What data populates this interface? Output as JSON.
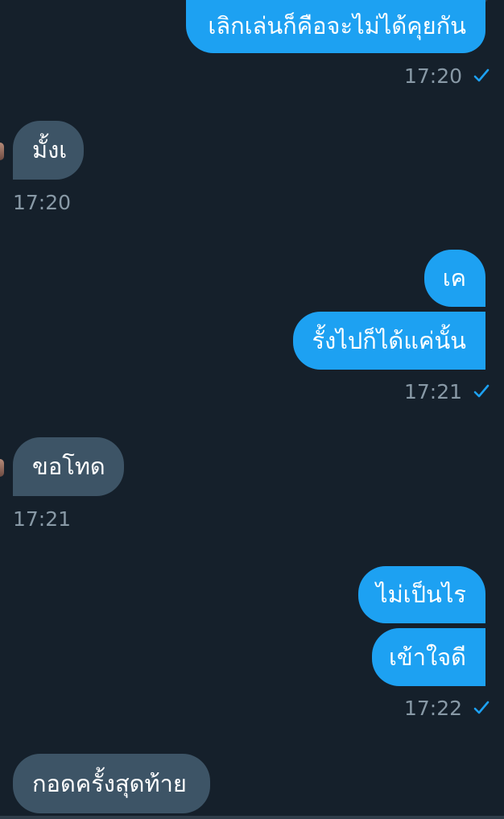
{
  "colors": {
    "background": "#15202b",
    "sent_bubble": "#1da1f2",
    "received_bubble": "#3d5466",
    "timestamp": "#8899a6",
    "read_check": "#1da1f2"
  },
  "messages": [
    {
      "direction": "sent",
      "text": "เลิกเล่นก็คือจะไม่ได้คุยกัน"
    },
    {
      "direction": "received",
      "text": "มั้งเ"
    },
    {
      "direction": "sent",
      "text": "เค"
    },
    {
      "direction": "sent",
      "text": "รั้งไปก็ได้แค่นั้น"
    },
    {
      "direction": "received",
      "text": "ขอโทด"
    },
    {
      "direction": "sent",
      "text": "ไม่เป็นไร"
    },
    {
      "direction": "sent",
      "text": "เข้าใจดี"
    },
    {
      "direction": "received",
      "text": "กอดครั้งสุดท้าย"
    }
  ],
  "timestamps": [
    "17:20",
    "17:20",
    "17:21",
    "17:21",
    "17:22"
  ],
  "icons": {
    "read_receipt": "check-icon",
    "sender_avatar": "avatar"
  }
}
